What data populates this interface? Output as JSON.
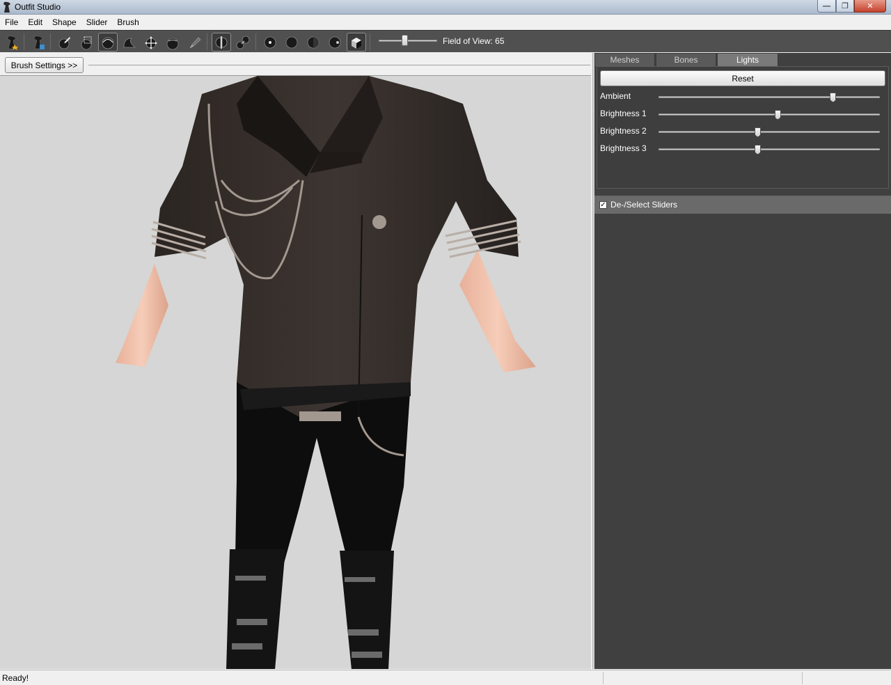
{
  "window": {
    "title": "Outfit Studio"
  },
  "menu": {
    "items": [
      "File",
      "Edit",
      "Shape",
      "Slider",
      "Brush"
    ]
  },
  "toolbar": {
    "fov_label": "Field of View: 65",
    "fov_value": 65
  },
  "viewport": {
    "brush_settings_label": "Brush Settings >>"
  },
  "right_panel": {
    "tabs": [
      "Meshes",
      "Bones",
      "Lights"
    ],
    "active_tab": "Lights",
    "reset_label": "Reset",
    "lights": [
      {
        "label": "Ambient",
        "level": 0.79
      },
      {
        "label": "Brightness 1",
        "level": 0.54
      },
      {
        "label": "Brightness 2",
        "level": 0.45
      },
      {
        "label": "Brightness 3",
        "level": 0.45
      }
    ],
    "sliders_header": "De-/Select Sliders",
    "sliders_checked": true
  },
  "statusbar": {
    "text": "Ready!"
  }
}
